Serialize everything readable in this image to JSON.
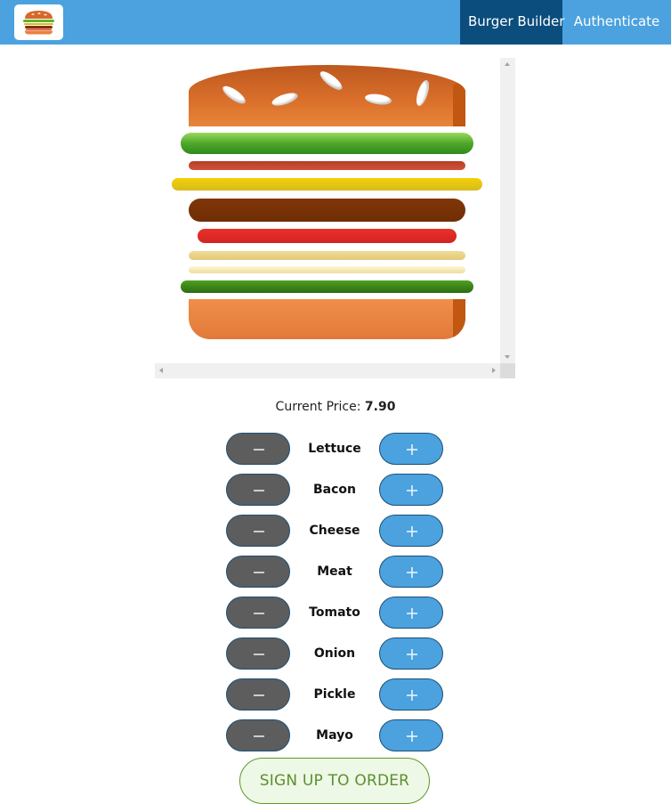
{
  "toolbar": {
    "logo_icon": "burger-logo-icon",
    "nav": [
      {
        "label": "Burger Builder",
        "active": true
      },
      {
        "label": "Authenticate",
        "active": false
      }
    ]
  },
  "burger": {
    "layers": [
      "bread-top",
      "lettuce",
      "bacon",
      "cheese",
      "meat",
      "tomato",
      "onion",
      "pickle",
      "bread-bottom"
    ]
  },
  "price": {
    "label": "Current Price:",
    "value": "7.90"
  },
  "controls": [
    {
      "label": "Lettuce"
    },
    {
      "label": "Bacon"
    },
    {
      "label": "Cheese"
    },
    {
      "label": "Meat"
    },
    {
      "label": "Tomato"
    },
    {
      "label": "Onion"
    },
    {
      "label": "Pickle"
    },
    {
      "label": "Mayo"
    }
  ],
  "order_button": {
    "label": "SIGN UP TO ORDER"
  },
  "colors": {
    "toolbar": "#4ba2df",
    "nav_active": "#0b4d7c",
    "less_button": "#5d5d5d",
    "more_button": "#4ba2df",
    "order_border": "#5c9a28"
  }
}
